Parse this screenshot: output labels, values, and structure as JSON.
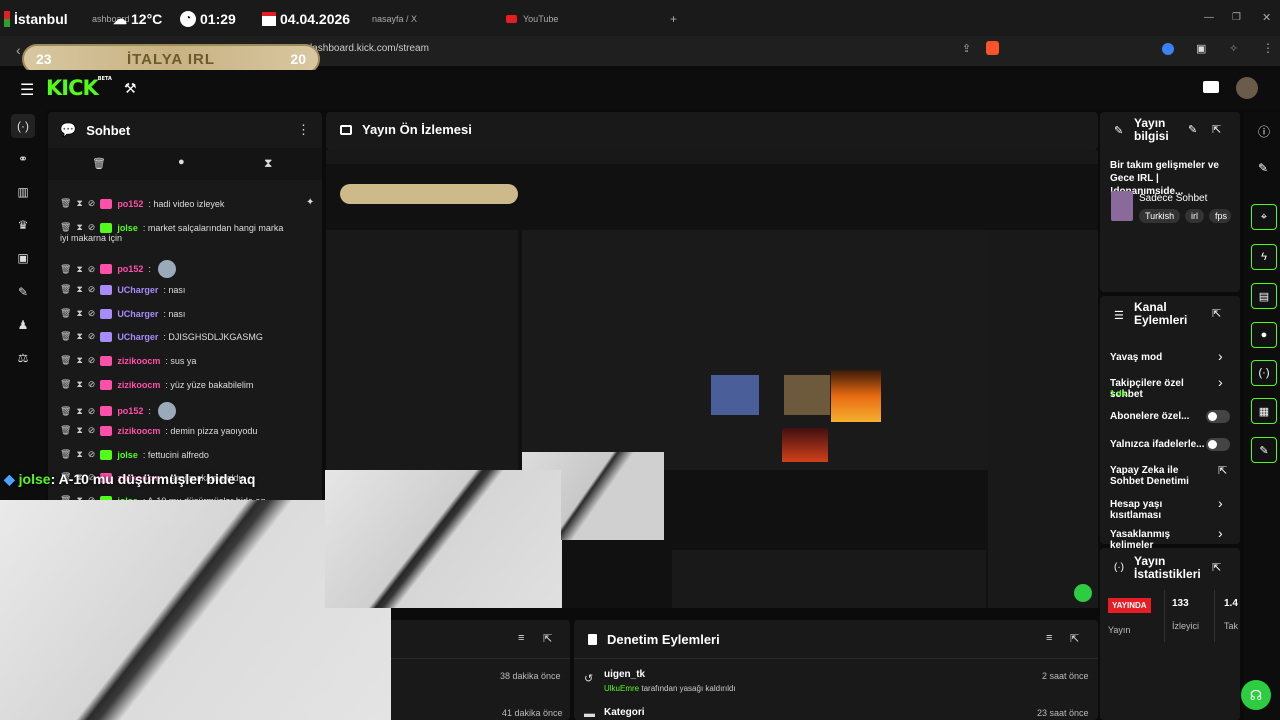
{
  "browser": {
    "tabs": [
      {
        "label": "ashboard",
        "dim": true
      },
      {
        "label": "ist",
        "dim": true
      },
      {
        "label": "nasayfa / X"
      },
      {
        "label": "YouTube"
      }
    ],
    "new_tab": "+",
    "url": "lashboard.kick.com/stream"
  },
  "overlay": {
    "city": "İstanbul",
    "temp": "12°C",
    "time": "01:29",
    "date": "04.04.2026",
    "score_left": "23",
    "score_title": "İTALYA IRL",
    "score_right": "20",
    "bottom_user": "jolse",
    "bottom_msg": ": A-10 mu düşürmüşler bide aq"
  },
  "header": {
    "logo": "KICK",
    "beta": "BETA"
  },
  "chat": {
    "title": "Sohbet",
    "messages": [
      {
        "user": "po152",
        "text": ": hadi video izleyek",
        "color": "#ff4fa8",
        "pinned": true
      },
      {
        "user": "jolse",
        "text": ": market salçalarından hangi marka",
        "cont": "iyi makarna için",
        "color": "#53fc18"
      },
      {
        "user": "po152",
        "text": ":",
        "color": "#ff4fa8",
        "emote": true
      },
      {
        "user": "UCharger",
        "text": ": nası",
        "color": "#a78bfa"
      },
      {
        "user": "UCharger",
        "text": ": nası",
        "color": "#a78bfa"
      },
      {
        "user": "UCharger",
        "text": ": DJISGHSDLJKGASMG",
        "color": "#a78bfa"
      },
      {
        "user": "zizikoocm",
        "text": ": sus ya",
        "color": "#ff4fa8"
      },
      {
        "user": "zizikoocm",
        "text": ": yüz yüze bakabilelim",
        "color": "#ff4fa8"
      },
      {
        "user": "po152",
        "text": ":",
        "color": "#ff4fa8",
        "emote": true
      },
      {
        "user": "zizikoocm",
        "text": ": demin pizza yaoıyodu",
        "color": "#ff4fa8"
      },
      {
        "user": "jolse",
        "text": ": fettucini alfredo",
        "color": "#53fc18"
      },
      {
        "user": "zizikoocm",
        "text": ": simi makarna oldu",
        "color": "#ff4fa8"
      },
      {
        "user": "jolse",
        "text": ": A-10 mu düşürmüşler bide aq",
        "color": "#53fc18"
      }
    ]
  },
  "preview": {
    "title": "Yayın Ön İzlemesi"
  },
  "panel_bottom_left": {
    "rows": [
      {
        "time": "38 dakika önce"
      },
      {
        "time": "41 dakika önce"
      }
    ]
  },
  "moderation": {
    "title": "Denetim Eylemleri",
    "items": [
      {
        "title": "uigen_tk",
        "actor": "UlkuEmre",
        "desc": "tarafından yasağı kaldırıldı",
        "time": "2 saat önce"
      },
      {
        "title": "Kategori",
        "time": "23 saat önce"
      }
    ]
  },
  "stream_info": {
    "title": "Yayın bilgisi",
    "desc": "Bir takım gelişmeler ve Gece IRL | !donanımside...",
    "category": "Sadece Sohbet",
    "tags": [
      "Turkish",
      "irl",
      "fps"
    ]
  },
  "channel_actions": {
    "title": "Kanal Eylemleri",
    "items": [
      {
        "label": "Yavaş mod",
        "type": "arrow"
      },
      {
        "label": "Takipçilere özel sohbet",
        "sub": "1 dk.",
        "type": "arrow"
      },
      {
        "label": "Abonelere özel...",
        "type": "toggle"
      },
      {
        "label": "Yalnızca ifadelerle...",
        "type": "toggle"
      },
      {
        "label": "Yapay Zeka ile Sohbet Denetimi",
        "type": "external"
      },
      {
        "label": "Hesap yaşı kısıtlaması",
        "type": "arrow"
      },
      {
        "label": "Yasaklanmış kelimeler",
        "type": "arrow"
      }
    ]
  },
  "stream_stats": {
    "title": "Yayın İstatistikleri",
    "live": "YAYINDA",
    "live_label": "Yayın",
    "viewers": "133",
    "viewers_label": "İzleyici",
    "third": "1.4",
    "third_label": "Tak"
  },
  "icons": {
    "accent": "#53fc18",
    "live_red": "#e81d24"
  }
}
